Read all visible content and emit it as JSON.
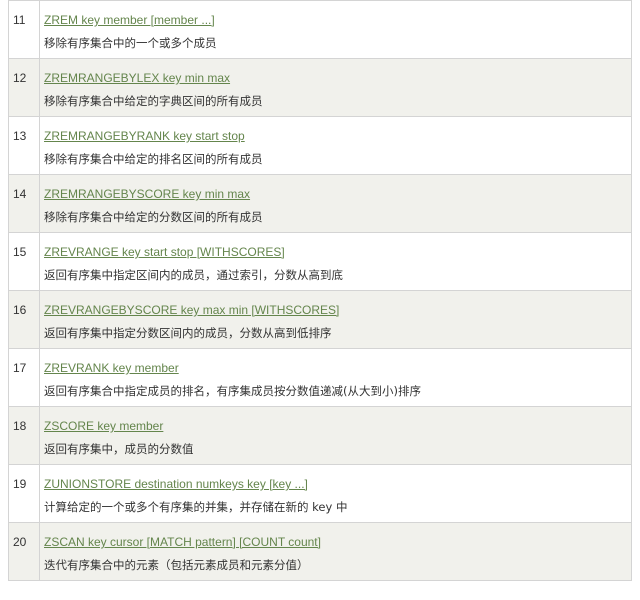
{
  "rows": [
    {
      "num": "11",
      "command": "ZREM key member [member ...]",
      "description": "移除有序集合中的一个或多个成员"
    },
    {
      "num": "12",
      "command": "ZREMRANGEBYLEX key min max",
      "description": "移除有序集合中给定的字典区间的所有成员"
    },
    {
      "num": "13",
      "command": "ZREMRANGEBYRANK key start stop",
      "description": "移除有序集合中给定的排名区间的所有成员"
    },
    {
      "num": "14",
      "command": "ZREMRANGEBYSCORE key min max",
      "description": "移除有序集合中给定的分数区间的所有成员"
    },
    {
      "num": "15",
      "command": "ZREVRANGE key start stop [WITHSCORES]",
      "description": "返回有序集中指定区间内的成员，通过索引，分数从高到底"
    },
    {
      "num": "16",
      "command": "ZREVRANGEBYSCORE key max min [WITHSCORES]",
      "description": "返回有序集中指定分数区间内的成员，分数从高到低排序"
    },
    {
      "num": "17",
      "command": "ZREVRANK key member",
      "description": "返回有序集合中指定成员的排名，有序集成员按分数值递减(从大到小)排序"
    },
    {
      "num": "18",
      "command": "ZSCORE key member",
      "description": "返回有序集中，成员的分数值"
    },
    {
      "num": "19",
      "command": "ZUNIONSTORE destination numkeys key [key ...]",
      "description": "计算给定的一个或多个有序集的并集，并存储在新的 key 中"
    },
    {
      "num": "20",
      "command": "ZSCAN key cursor [MATCH pattern] [COUNT count]",
      "description": "迭代有序集合中的元素（包括元素成员和元素分值）"
    }
  ]
}
